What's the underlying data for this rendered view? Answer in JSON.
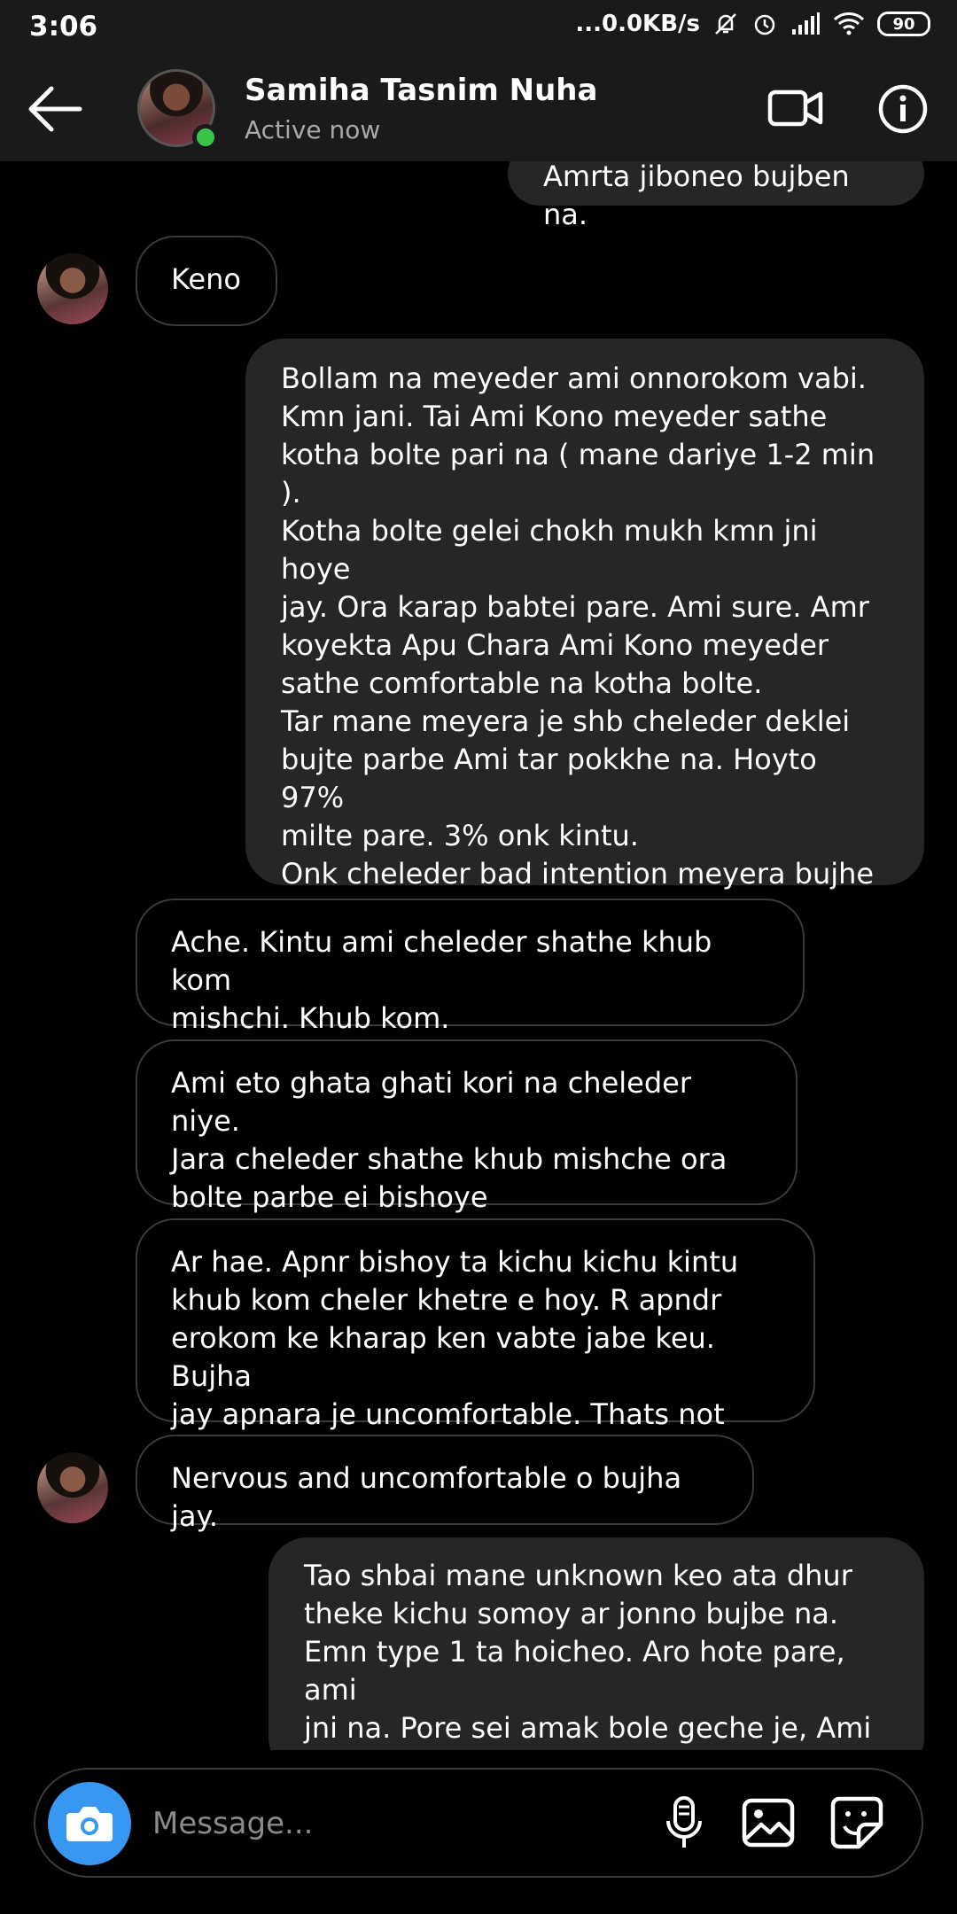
{
  "status_bar": {
    "time": "3:06",
    "network": "...0.0KB/s",
    "battery": "90"
  },
  "header": {
    "name": "Samiha Tasnim Nuha",
    "status": "Active now"
  },
  "messages": [
    {
      "from": "me",
      "text": "Amrta jiboneo bujben na."
    },
    {
      "from": "them",
      "text": "Keno"
    },
    {
      "from": "me",
      "text": "Bollam na meyeder ami onnorokom vabi.\nKmn jani. Tai Ami Kono meyeder sathe\nkotha bolte pari na ( mane dariye 1-2 min ).\nKotha bolte gelei chokh mukh kmn jni hoye\njay. Ora karap babtei pare. Ami sure. Amr\nkoyekta Apu Chara Ami Kono meyeder\nsathe comfortable na kotha bolte.\nTar mane meyera je shb cheleder deklei\nbujte parbe Ami tar pokkhe na. Hoyto 97%\nmilte pare. 3% onk kintu.\nOnk cheleder bad intention meyera bujhe\nna Nuha. Vabe eyy cheletai onk vlo. Erokom\nache na???"
    },
    {
      "from": "them",
      "text": "Ache. Kintu ami cheleder shathe khub kom\nmishchi. Khub kom."
    },
    {
      "from": "them",
      "text": "Ami eto ghata ghati kori na cheleder niye.\nJara cheleder shathe khub mishche ora\nbolte parbe ei bishoye"
    },
    {
      "from": "them",
      "text": "Ar hae. Apnr bishoy ta kichu kichu kintu\nkhub kom cheler khetre e hoy. R apndr\nerokom ke kharap ken vabte jabe keu. Bujha\njay apnara je uncomfortable. Thats not bad"
    },
    {
      "from": "them",
      "text": "Nervous and uncomfortable o bujha jay."
    },
    {
      "from": "me",
      "text": "Tao shbai mane unknown keo ata dhur\ntheke kichu somoy ar jonno bujbe na.\nEmn type 1 ta hoicheo. Aro hote pare, ami\njni na. Pore sei amak bole geche je, Ami e\nshb theke vlo"
    }
  ],
  "composer": {
    "placeholder": "Message..."
  },
  "icons": {
    "back": "arrow-left-icon",
    "video": "video-camera-icon",
    "info": "info-icon",
    "camera": "camera-icon",
    "mic": "microphone-icon",
    "gallery": "image-icon",
    "sticker": "sticker-icon"
  },
  "colors": {
    "accent": "#3897f0",
    "online": "#3ac34a",
    "sent_bubble": "#262626",
    "header_bg": "#1a1a1a"
  }
}
